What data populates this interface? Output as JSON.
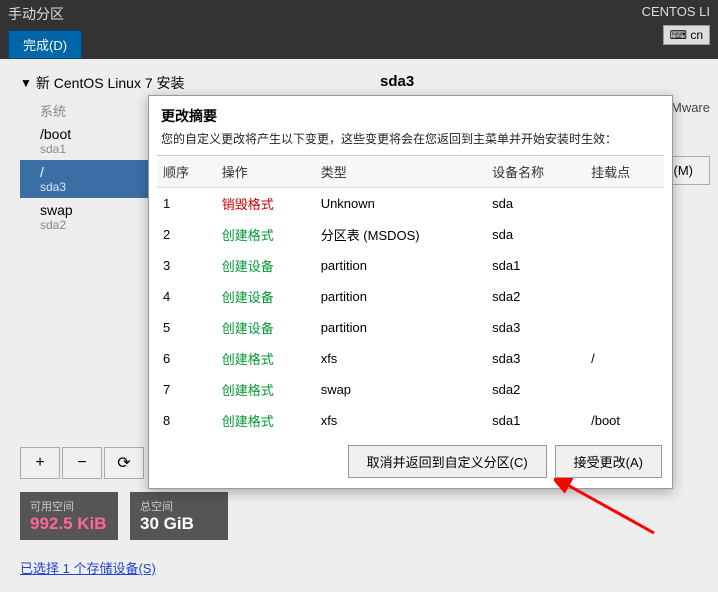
{
  "topbar": {
    "title": "手动分区",
    "done": "完成(D)",
    "os": "CENTOS LI",
    "lang_icon": "⌨",
    "lang": "cn"
  },
  "sidebar": {
    "install_title": "新 CentOS Linux 7 安装",
    "sys_label": "系统",
    "items": [
      {
        "name": "/boot",
        "dev": "sda1",
        "selected": false
      },
      {
        "name": "/",
        "dev": "sda3",
        "selected": true
      },
      {
        "name": "swap",
        "dev": "sda2",
        "selected": false
      }
    ]
  },
  "detail": {
    "device_heading": "sda3",
    "extra": "e, VMware",
    "modify_btn": "…(M)",
    "trailing": ")："
  },
  "dialog": {
    "title": "更改摘要",
    "subtitle": "您的自定义更改将产生以下变更，这些变更将会在您返回到主菜单并开始安装时生效：",
    "headers": {
      "order": "顺序",
      "op": "操作",
      "type": "类型",
      "dev": "设备名称",
      "mount": "挂载点"
    },
    "rows": [
      {
        "order": "1",
        "op": "销毁格式",
        "op_kind": "destroy",
        "type": "Unknown",
        "dev": "sda",
        "mount": ""
      },
      {
        "order": "2",
        "op": "创建格式",
        "op_kind": "create",
        "type": "分区表 (MSDOS)",
        "dev": "sda",
        "mount": ""
      },
      {
        "order": "3",
        "op": "创建设备",
        "op_kind": "create",
        "type": "partition",
        "dev": "sda1",
        "mount": ""
      },
      {
        "order": "4",
        "op": "创建设备",
        "op_kind": "create",
        "type": "partition",
        "dev": "sda2",
        "mount": ""
      },
      {
        "order": "5",
        "op": "创建设备",
        "op_kind": "create",
        "type": "partition",
        "dev": "sda3",
        "mount": ""
      },
      {
        "order": "6",
        "op": "创建格式",
        "op_kind": "create",
        "type": "xfs",
        "dev": "sda3",
        "mount": "/"
      },
      {
        "order": "7",
        "op": "创建格式",
        "op_kind": "create",
        "type": "swap",
        "dev": "sda2",
        "mount": ""
      },
      {
        "order": "8",
        "op": "创建格式",
        "op_kind": "create",
        "type": "xfs",
        "dev": "sda1",
        "mount": "/boot"
      }
    ],
    "cancel": "取消并返回到自定义分区(C)",
    "accept": "接受更改(A)"
  },
  "toolbar": {
    "add": "+",
    "remove": "−",
    "reload": "⟳"
  },
  "footer": {
    "avail_label": "可用空间",
    "avail_value": "992.5 KiB",
    "total_label": "总空间",
    "total_value": "30 GiB"
  },
  "storage_link": "已选择 1 个存储设备(S)"
}
